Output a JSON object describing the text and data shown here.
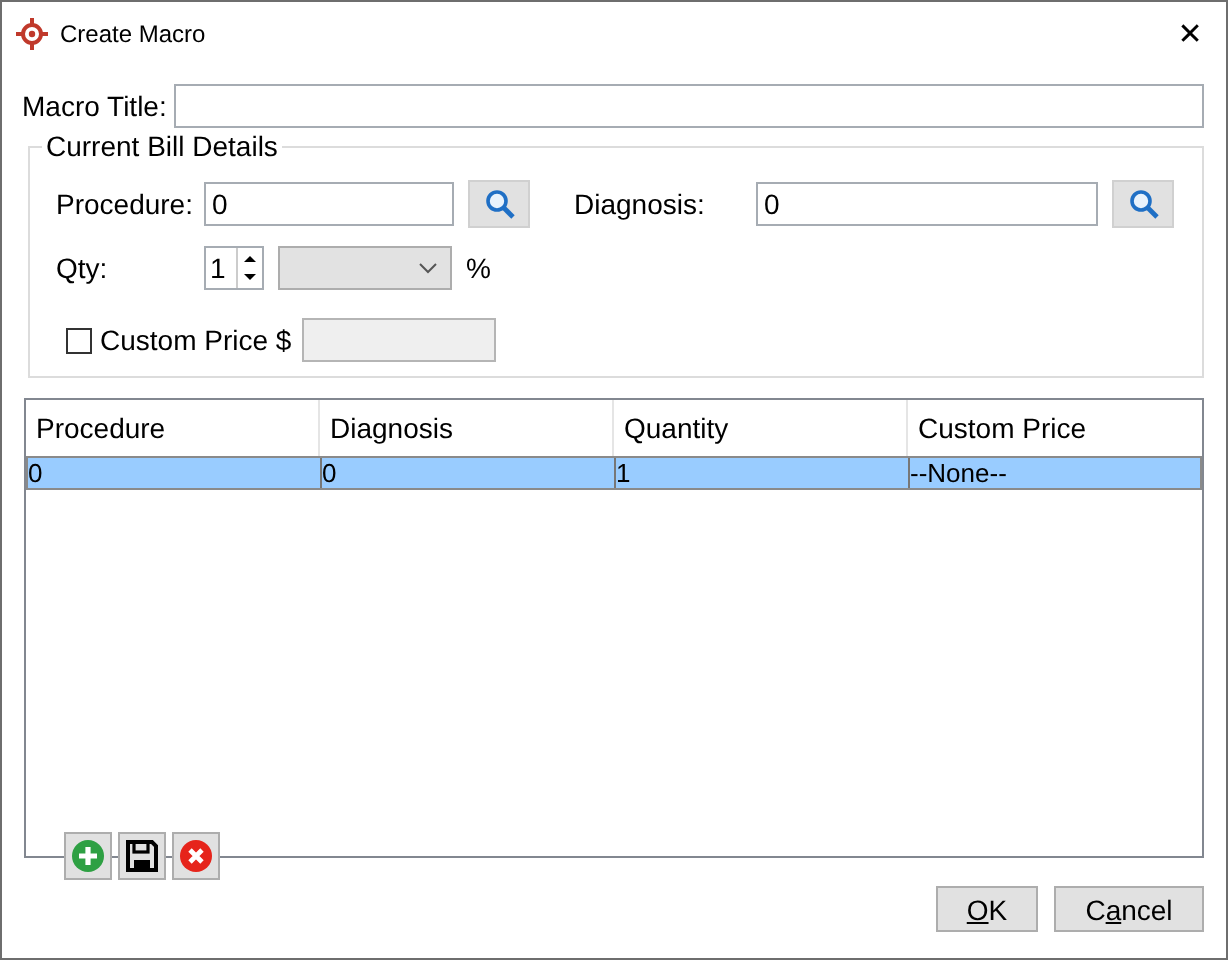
{
  "window": {
    "title": "Create Macro",
    "close": "✕"
  },
  "macro_title": {
    "label": "Macro Title:"
  },
  "bill_details": {
    "title": "Current Bill Details",
    "procedure": {
      "label": "Procedure:",
      "value": "0"
    },
    "diagnosis": {
      "label": "Diagnosis:",
      "value": "0"
    },
    "qty": {
      "label": "Qty:",
      "value": "1",
      "unit": "%",
      "percent_disabled": true
    },
    "custom_price": {
      "label": "Custom Price $",
      "checked": false,
      "disabled": true
    }
  },
  "table": {
    "columns": [
      "Procedure",
      "Diagnosis",
      "Quantity",
      "Custom Price"
    ],
    "rows": [
      {
        "cells": [
          "0",
          "0",
          "1",
          "--None--"
        ],
        "selected": true
      }
    ]
  },
  "toolbar": [
    {
      "kind": "add"
    },
    {
      "kind": "save"
    },
    {
      "kind": "delete"
    }
  ],
  "buttons": [
    {
      "label": [
        {
          "text": "O",
          "underline": true
        },
        {
          "text": "K",
          "underline": false
        }
      ]
    },
    {
      "label": [
        {
          "text": "C",
          "underline": false
        },
        {
          "text": "a",
          "underline": true
        },
        {
          "text": "ncel",
          "underline": false
        }
      ]
    }
  ]
}
